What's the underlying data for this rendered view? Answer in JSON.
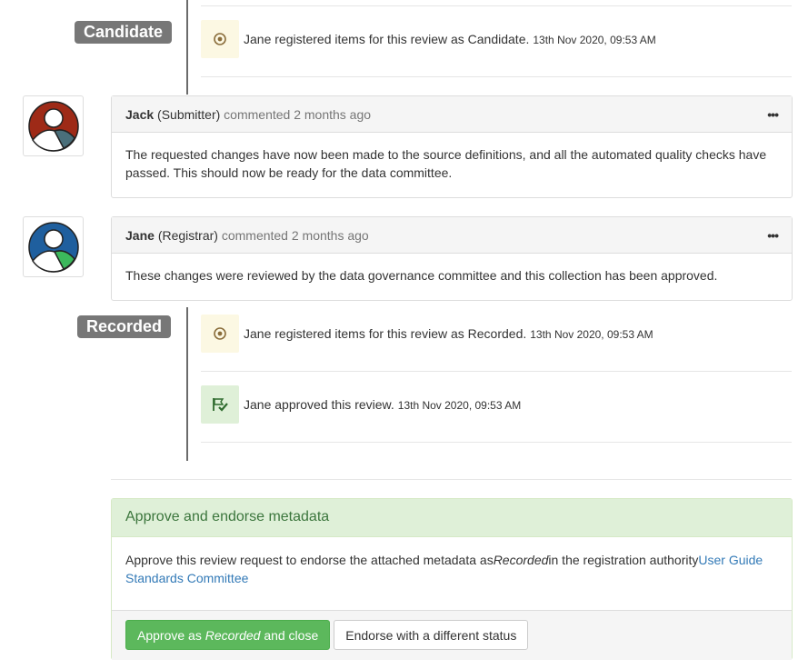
{
  "timeline": {
    "candidate": {
      "label": "Candidate",
      "event": {
        "icon": "status-circle-icon",
        "text": "Jane registered items for this review as Candidate.",
        "time": "13th Nov 2020, 09:53 AM"
      }
    },
    "recorded": {
      "label": "Recorded",
      "events": [
        {
          "icon": "status-circle-icon",
          "text": "Jane registered items for this review as Recorded.",
          "time": "13th Nov 2020, 09:53 AM"
        },
        {
          "icon": "flag-check-icon",
          "text": "Jane approved this review.",
          "time": "13th Nov 2020, 09:53 AM"
        }
      ]
    }
  },
  "comments": [
    {
      "author": "Jack",
      "role": "(Submitter)",
      "action": "commented 2 months ago",
      "menu": "•••",
      "body": "The requested changes have now been made to the source definitions, and all the automated quality checks have passed. This should now be ready for the data committee.",
      "avatar_color": "#9e2a17",
      "avatar_accent": "#4a6f7a"
    },
    {
      "author": "Jane",
      "role": "(Registrar)",
      "action": "commented 2 months ago",
      "menu": "•••",
      "body": "These changes were reviewed by the data governance committee and this collection has been approved.",
      "avatar_color": "#1f5f9e",
      "avatar_accent": "#3cb85c"
    }
  ],
  "approve_panel": {
    "title": "Approve and endorse metadata",
    "body_prefix": "Approve this review request to endorse the attached metadata as ",
    "body_status": "Recorded",
    "body_mid": " in the registration authority ",
    "authority_link": "User Guide Standards Committee",
    "approve_button_prefix": "Approve as ",
    "approve_button_status": "Recorded",
    "approve_button_suffix": " and close",
    "endorse_button": "Endorse with a different status"
  },
  "colors": {
    "success": "#5cb85c",
    "panel_green": "#dff0d8",
    "status_yellow": "#fcf8e3",
    "link": "#337ab7"
  }
}
